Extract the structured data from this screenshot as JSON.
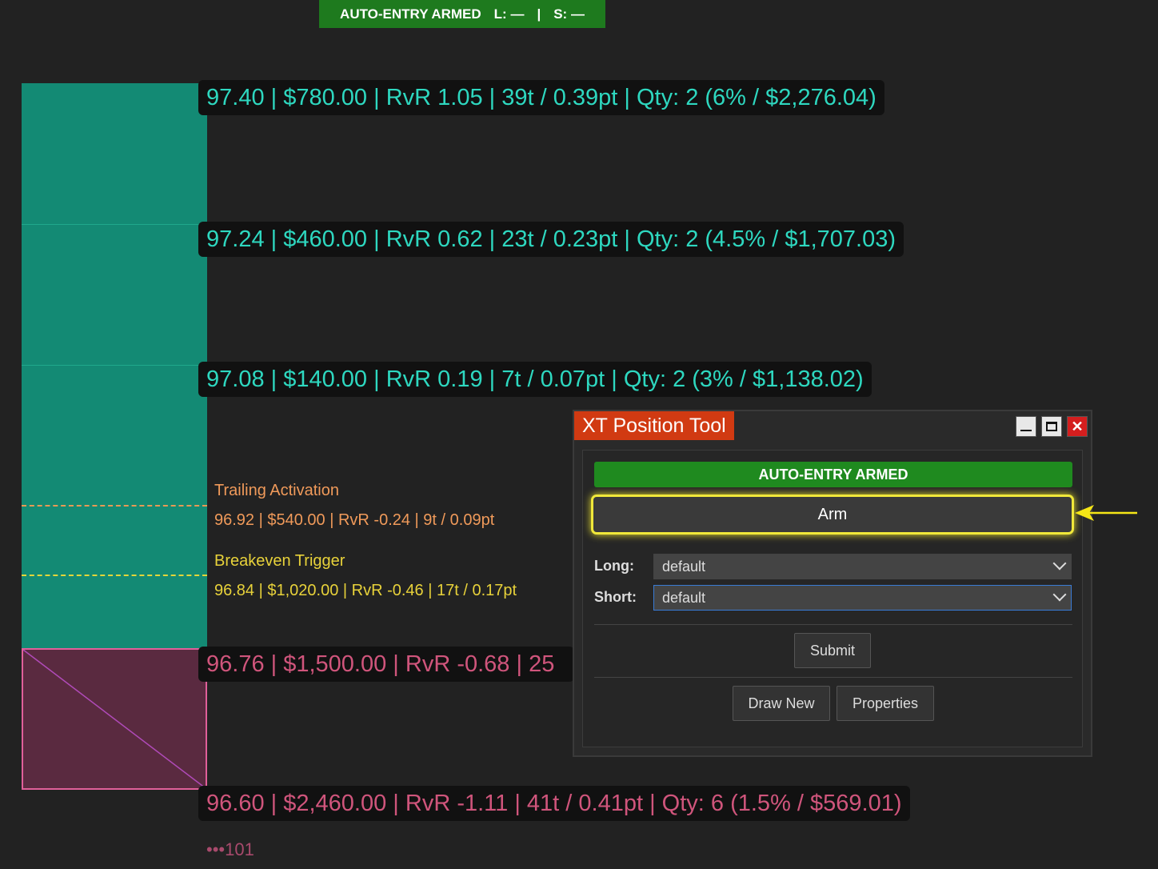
{
  "banner": {
    "status": "AUTO-ENTRY ARMED",
    "long": "L: —",
    "sep": "|",
    "short": "S: —"
  },
  "levels": {
    "tp1": "97.40 | $780.00 | RvR 1.05 | 39t / 0.39pt | Qty: 2 (6% / $2,276.04)",
    "tp2": "97.24 | $460.00 | RvR 0.62 | 23t / 0.23pt | Qty: 2 (4.5% / $1,707.03)",
    "tp3": "97.08 | $140.00 | RvR 0.19 | 7t / 0.07pt | Qty: 2 (3% / $1,138.02)",
    "entry": "96.76 | $1,500.00 | RvR -0.68 | 25",
    "stop": "96.60 | $2,460.00 | RvR -1.11 | 41t / 0.41pt | Qty: 6 (1.5% / $569.01)"
  },
  "annotations": {
    "trailing_title": "Trailing Activation",
    "trailing_value": "96.92 | $540.00 | RvR -0.24 | 9t / 0.09pt",
    "breakeven_title": "Breakeven Trigger",
    "breakeven_value": "96.84 | $1,020.00 | RvR -0.46 | 17t / 0.17pt"
  },
  "tick_label": "•••101",
  "dialog": {
    "title": "XT Position Tool",
    "status": "AUTO-ENTRY ARMED",
    "arm_label": "Arm",
    "long_label": "Long:",
    "long_value": "default",
    "short_label": "Short:",
    "short_value": "default",
    "submit_label": "Submit",
    "draw_new_label": "Draw New",
    "properties_label": "Properties",
    "close_glyph": "✕"
  },
  "colors": {
    "profit": "#138a74",
    "loss": "#5a2a40",
    "armed": "#1f8a1f",
    "highlight": "#f0e83a",
    "title": "#d13a12"
  },
  "icons": [
    "minimize-icon",
    "maximize-icon",
    "close-icon",
    "chevron-down-icon",
    "pointer-arrow-icon"
  ]
}
